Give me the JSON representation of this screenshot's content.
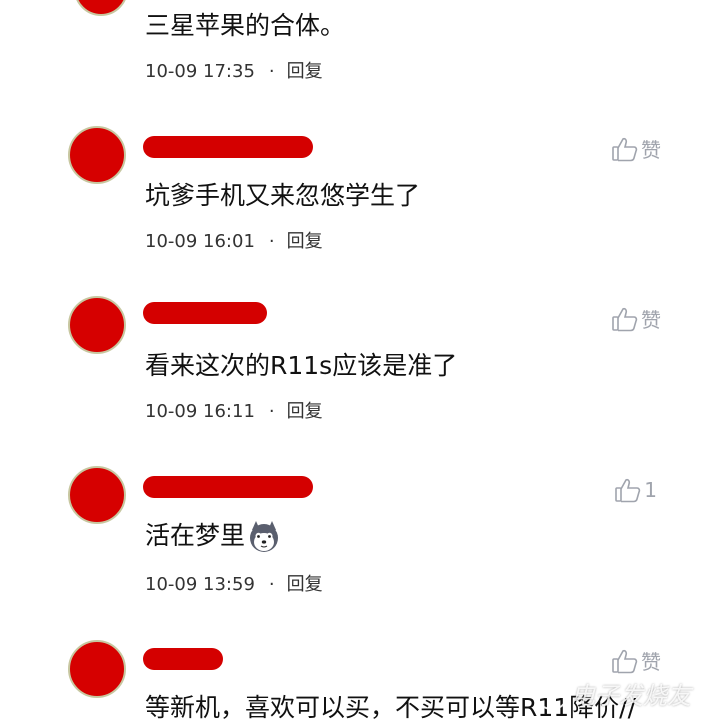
{
  "comments": [
    {
      "text": "三星苹果的合体。",
      "time": "10-09 17:35",
      "reply": "回复"
    },
    {
      "text": "坑爹手机又来忽悠学生了",
      "time": "10-09 16:01",
      "reply": "回复",
      "like": "赞"
    },
    {
      "text": "看来这次的R11s应该是准了",
      "time": "10-09 16:11",
      "reply": "回复",
      "like": "赞"
    },
    {
      "text": "活在梦里",
      "time": "10-09 13:59",
      "reply": "回复",
      "like": "1"
    },
    {
      "text": "等新机，喜欢可以买，不买可以等R11降价//",
      "like": "赞"
    }
  ],
  "meta_separator": "·",
  "icons": {
    "like": "thumbs-up-icon",
    "emoji": "husky-dog-emoji-icon"
  },
  "colors": {
    "redaction": "#d40000",
    "like_icon": "#a0a4ad",
    "text": "#111111",
    "meta": "#333333"
  },
  "watermark": {
    "text": "电子发烧友"
  }
}
